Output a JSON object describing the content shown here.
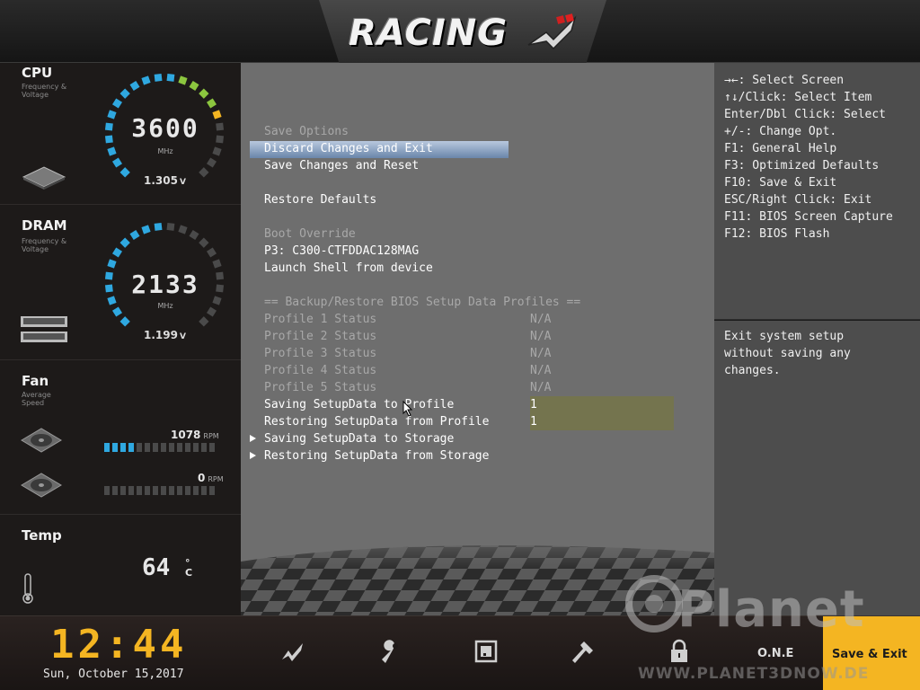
{
  "header": {
    "logo_text": "RACING"
  },
  "monitor": {
    "cpu": {
      "title": "CPU",
      "subtitle": "Frequency & Voltage",
      "value": "3600",
      "unit": "MHz",
      "voltage": "1.305",
      "voltage_unit": "V",
      "level": 0.75
    },
    "dram": {
      "title": "DRAM",
      "subtitle": "Frequency & Voltage",
      "value": "2133",
      "unit": "MHz",
      "voltage": "1.199",
      "voltage_unit": "V",
      "level": 0.5
    },
    "fan": {
      "title": "Fan",
      "subtitle": "Average Speed",
      "fans": [
        {
          "rpm": "1078",
          "rpm_unit": "RPM",
          "level_bars": 4,
          "total_bars": 14
        },
        {
          "rpm": "0",
          "rpm_unit": "RPM",
          "level_bars": 0,
          "total_bars": 14
        }
      ]
    },
    "temp": {
      "title": "Temp",
      "value": "64",
      "unit_top": "°",
      "unit_bottom": "C"
    }
  },
  "menu": {
    "items": [
      {
        "label": "Save Options",
        "value": "",
        "style": "dim"
      },
      {
        "label": "Discard Changes and Exit",
        "value": "",
        "style": "selected"
      },
      {
        "label": "Save Changes and Reset",
        "value": "",
        "style": "white"
      },
      {
        "label": "Restore Defaults",
        "value": "",
        "style": "white"
      },
      {
        "label": "Boot Override",
        "value": "",
        "style": "dim"
      },
      {
        "label": "P3: C300-CTFDDAC128MAG",
        "value": "",
        "style": "white"
      },
      {
        "label": "Launch Shell from device",
        "value": "",
        "style": "white"
      },
      {
        "label": "== Backup/Restore BIOS Setup Data Profiles ==",
        "value": "",
        "style": "dim"
      },
      {
        "label": "Profile 1 Status",
        "value": "N/A",
        "style": "dim"
      },
      {
        "label": "Profile 2 Status",
        "value": "N/A",
        "style": "dim"
      },
      {
        "label": "Profile 3 Status",
        "value": "N/A",
        "style": "dim"
      },
      {
        "label": "Profile 4 Status",
        "value": "N/A",
        "style": "dim"
      },
      {
        "label": "Profile 5 Status",
        "value": "N/A",
        "style": "dim"
      },
      {
        "label": "Saving SetupData to Profile",
        "value": "1",
        "style": "white"
      },
      {
        "label": "Restoring SetupData from Profile",
        "value": "1",
        "style": "white"
      },
      {
        "label": "Saving SetupData to Storage",
        "value": "",
        "style": "white"
      },
      {
        "label": "Restoring SetupData from Storage",
        "value": "",
        "style": "white"
      }
    ]
  },
  "help": {
    "keys": [
      "→←: Select Screen",
      "↑↓/Click: Select Item",
      "Enter/Dbl Click: Select",
      "+/-: Change Opt.",
      "F1: General Help",
      "F3: Optimized Defaults",
      "F10: Save & Exit",
      "ESC/Right Click: Exit",
      "F11: BIOS Screen Capture",
      "F12: BIOS Flash"
    ],
    "description": [
      "Exit system setup",
      "without saving any",
      "changes."
    ]
  },
  "footer": {
    "time": "12:44",
    "date": "Sun, October  15,2017",
    "one_label": "O.N.E",
    "save_exit_label": "Save & Exit",
    "accent": "#f4b522"
  },
  "watermark": {
    "brand": "Planet",
    "url": "WWW.PLANET3DNOW.DE"
  },
  "colors": {
    "gauge_blue": "#2fa8e0",
    "gauge_green": "#8cc63f",
    "gauge_yellow": "#f4b522",
    "selection": "#8aa4c6"
  }
}
